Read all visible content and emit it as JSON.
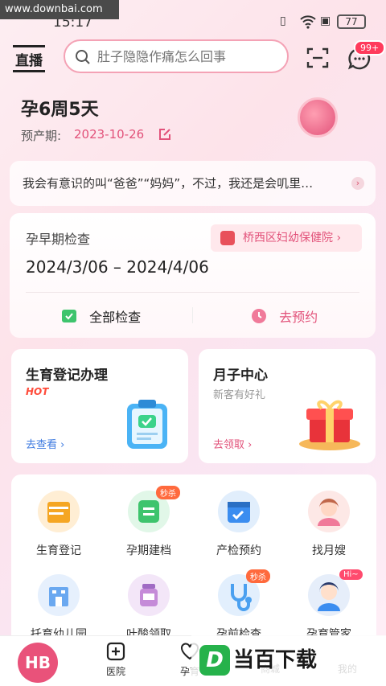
{
  "watermark": "www.downbai.com",
  "status": {
    "time": "15:17",
    "battery": "77"
  },
  "header": {
    "logo": "直播",
    "search_placeholder": "肚子隐隐作痛怎么回事",
    "msg_badge": "99+"
  },
  "pregnancy": {
    "weeks": "孕6周5天",
    "due_label": "预产期:",
    "due_date": "2023-10-26"
  },
  "tip": "我会有意识的叫“爸爸”“妈妈”，不过，我还是会叽里…",
  "exam": {
    "title": "孕早期检查",
    "hospital": "桥西区妇幼保健院",
    "range": "2024/3/06 – 2024/4/06",
    "all": "全部检查",
    "book": "去预约"
  },
  "services": [
    {
      "title": "生育登记办理",
      "tag": "HOT",
      "link": "去查看"
    },
    {
      "title": "月子中心",
      "sub": "新客有好礼",
      "link": "去领取"
    }
  ],
  "grid": [
    {
      "label": "生育登记",
      "color": "#f5a623"
    },
    {
      "label": "孕期建档",
      "color": "#3ec46d",
      "tag": "秒杀"
    },
    {
      "label": "产检预约",
      "color": "#3b8df0"
    },
    {
      "label": "找月嫂",
      "color": "#f6a7a0"
    },
    {
      "label": "托育幼儿园",
      "color": "#6aa8f0"
    },
    {
      "label": "叶酸领取",
      "color": "#c58bd8"
    },
    {
      "label": "孕前检查",
      "color": "#4aa0f0",
      "tag": "秒杀"
    },
    {
      "label": "孕育管家",
      "color": "#8fb8e8",
      "tag": "Hi~"
    }
  ],
  "nav": {
    "logo": "HB",
    "tabs": [
      "医院",
      "孕育",
      "商城",
      "我的"
    ]
  },
  "brand_watermark": "当百下载"
}
